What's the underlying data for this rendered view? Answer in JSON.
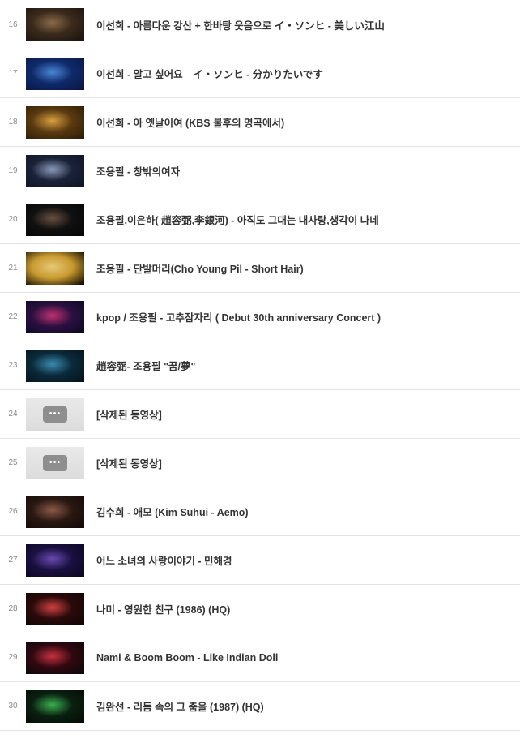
{
  "playlist": {
    "items": [
      {
        "index": "16",
        "title": "이선희 - 아름다운 강산 + 한바탕 웃음으로 イ・ソンヒ - 美しい江山",
        "thumbnail": "video-thumbnail",
        "colors": [
          "#3a2a1c",
          "#8a6a48",
          "#1a120c"
        ]
      },
      {
        "index": "17",
        "title": "이선희 - 알고 싶어요　イ・ソンヒ - 分かりたいです",
        "thumbnail": "video-thumbnail",
        "colors": [
          "#0f2a6a",
          "#4a86d6",
          "#0a1540"
        ]
      },
      {
        "index": "18",
        "title": "이선희 - 아 옛날이여 (KBS 불후의 명곡에서)",
        "thumbnail": "video-thumbnail",
        "colors": [
          "#5a3a10",
          "#d8a040",
          "#2a1a08"
        ]
      },
      {
        "index": "19",
        "title": "조용필 - 창밖의여자",
        "thumbnail": "video-thumbnail",
        "colors": [
          "#1a2238",
          "#8a9ab8",
          "#0e1424"
        ]
      },
      {
        "index": "20",
        "title": "조용필,이은하( 趙容弼,李銀河) - 아직도 그대는 내사랑,생각이 나네",
        "thumbnail": "video-thumbnail",
        "colors": [
          "#101010",
          "#6a5040",
          "#050505"
        ]
      },
      {
        "index": "21",
        "title": "조용필 - 단발머리(Cho Young Pil - Short Hair)",
        "thumbnail": "video-thumbnail",
        "colors": [
          "#c89a30",
          "#e8c878",
          "#000000"
        ]
      },
      {
        "index": "22",
        "title": "kpop / 조용필 - 고추잠자리 ( Debut 30th anniversary Concert )",
        "thumbnail": "video-thumbnail",
        "colors": [
          "#2a1040",
          "#c03070",
          "#0a0820"
        ]
      },
      {
        "index": "23",
        "title": "趙容弼- 조용필 \"꿈/夢\"",
        "thumbnail": "video-thumbnail",
        "colors": [
          "#0a2a3a",
          "#3a8ab0",
          "#061018"
        ]
      },
      {
        "index": "24",
        "title": "[삭제된 동영상]",
        "thumbnail": "deleted-video-placeholder",
        "colors": []
      },
      {
        "index": "25",
        "title": "[삭제된 동영상]",
        "thumbnail": "deleted-video-placeholder",
        "colors": []
      },
      {
        "index": "26",
        "title": "김수희 - 애모 (Kim Suhui - Aemo)",
        "thumbnail": "video-thumbnail",
        "colors": [
          "#2a1812",
          "#8a5a48",
          "#120806"
        ]
      },
      {
        "index": "27",
        "title": "어느 소녀의 사랑이야기 - 민해경",
        "thumbnail": "video-thumbnail",
        "colors": [
          "#1a1040",
          "#6a4ab0",
          "#0a0620"
        ]
      },
      {
        "index": "28",
        "title": "나미 - 영원한 친구 (1986) (HQ)",
        "thumbnail": "video-thumbnail",
        "colors": [
          "#2a0a0a",
          "#d04040",
          "#100404"
        ]
      },
      {
        "index": "29",
        "title": "Nami & Boom Boom - Like Indian Doll",
        "thumbnail": "video-thumbnail",
        "colors": [
          "#300810",
          "#c83040",
          "#080808"
        ]
      },
      {
        "index": "30",
        "title": "김완선 - 리듬 속의 그 춤을 (1987) (HQ)",
        "thumbnail": "video-thumbnail",
        "colors": [
          "#0a2010",
          "#3ab050",
          "#040a04"
        ]
      }
    ],
    "deleted_badge_text": "•••"
  }
}
